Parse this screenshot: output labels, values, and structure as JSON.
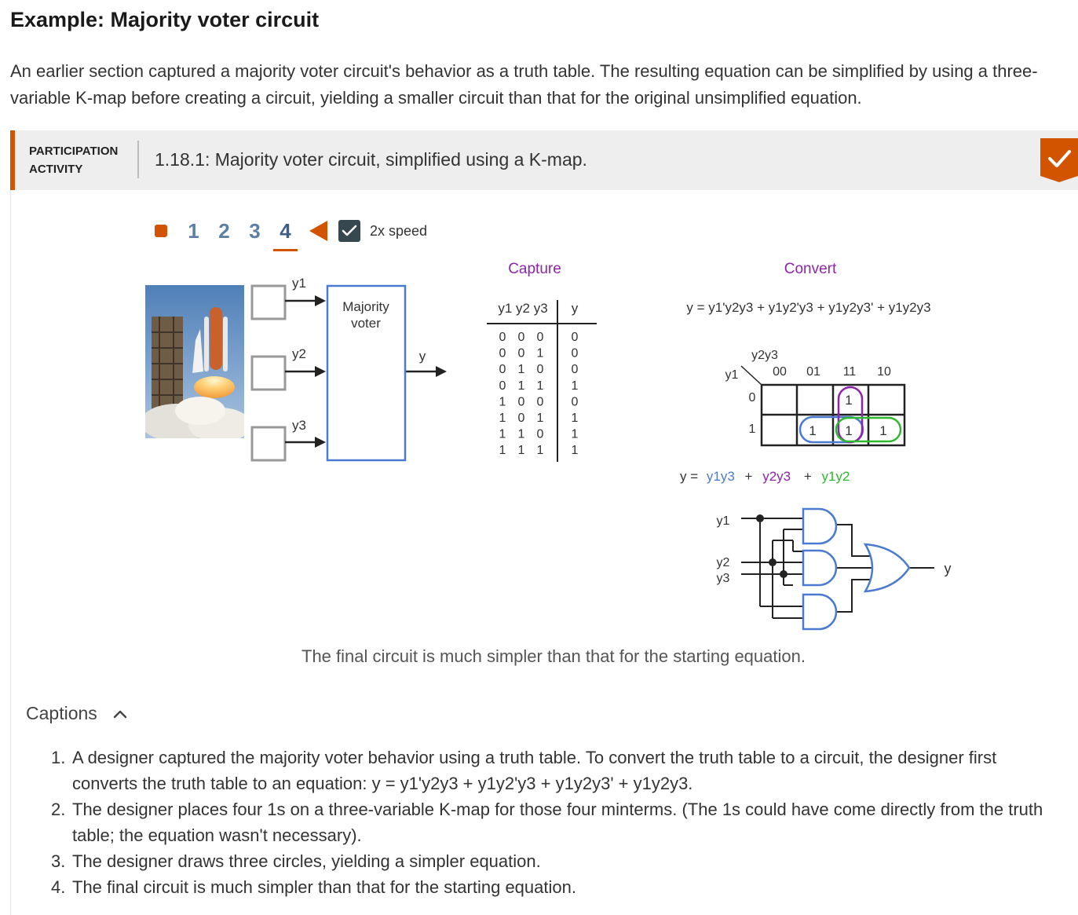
{
  "section": {
    "title": "Example: Majority voter circuit",
    "intro": "An earlier section captured a majority voter circuit's behavior as a truth table. The resulting equation can be simplified by using a three-variable K-map before creating a circuit, yielding a smaller circuit than that for the original unsimplified equation."
  },
  "activity": {
    "label_line1": "PARTICIPATION",
    "label_line2": "ACTIVITY",
    "title": "1.18.1: Majority voter circuit, simplified using a K-map.",
    "completed_icon": "checkmark-icon",
    "accent_color": "#d35400"
  },
  "stepper": {
    "steps": [
      "1",
      "2",
      "3",
      "4"
    ],
    "active_step": "4",
    "speed_label": "2x speed",
    "speed_checked": true
  },
  "animation": {
    "capture_heading": "Capture",
    "convert_heading": "Convert",
    "block": {
      "line1": "Majority",
      "line2": "voter",
      "inputs": [
        "y1",
        "y2",
        "y3"
      ],
      "output": "y"
    },
    "truth_table": {
      "header_inputs": "y1 y2 y3",
      "header_output": "y",
      "rows": [
        [
          "0",
          "0",
          "0",
          "0"
        ],
        [
          "0",
          "0",
          "1",
          "0"
        ],
        [
          "0",
          "1",
          "0",
          "0"
        ],
        [
          "0",
          "1",
          "1",
          "1"
        ],
        [
          "1",
          "0",
          "0",
          "0"
        ],
        [
          "1",
          "0",
          "1",
          "1"
        ],
        [
          "1",
          "1",
          "0",
          "1"
        ],
        [
          "1",
          "1",
          "1",
          "1"
        ]
      ]
    },
    "equation": "y = y1'y2y3 + y1y2'y3 + y1y2y3' + y1y2y3",
    "kmap": {
      "col_var": "y2y3",
      "row_var": "y1",
      "cols": [
        "00",
        "01",
        "11",
        "10"
      ],
      "rows": [
        "0",
        "1"
      ],
      "cells": [
        [
          "",
          "",
          "1",
          ""
        ],
        [
          "",
          "1",
          "1",
          "1"
        ]
      ]
    },
    "simplified": {
      "prefix": "y =",
      "term1": "y1y3",
      "term2": "y2y3",
      "term3": "y1y2",
      "plus": "+",
      "colors": {
        "term1": "#4a7bd0",
        "term2": "#8e24aa",
        "term3": "#2eb82e"
      }
    },
    "circuit": {
      "inputs": [
        "y1",
        "y2",
        "y3"
      ],
      "output": "y"
    },
    "heading_color": "#8e24aa",
    "final_caption": "The final circuit is much simpler than that for the starting equation."
  },
  "captions": {
    "toggle_label": "Captions",
    "items": [
      {
        "num": "1.",
        "text": "A designer captured the majority voter behavior using a truth table. To convert the truth table to a circuit, the designer first converts the truth table to an equation: y = y1'y2y3 + y1y2'y3 + y1y2y3' + y1y2y3."
      },
      {
        "num": "2.",
        "text": "The designer places four 1s on a three-variable K-map for those four minterms. (The 1s could have come directly from the truth table; the equation wasn't necessary)."
      },
      {
        "num": "3.",
        "text": "The designer draws three circles, yielding a simpler equation."
      },
      {
        "num": "4.",
        "text": "The final circuit is much simpler than that for the starting equation."
      }
    ]
  }
}
